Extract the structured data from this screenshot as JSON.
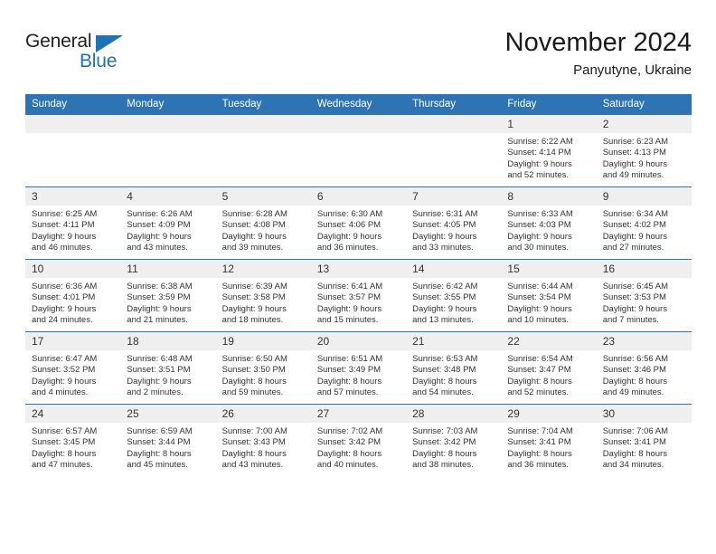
{
  "logo": {
    "word1": "General",
    "word2": "Blue",
    "triangle_color": "#1f72b8"
  },
  "header": {
    "title": "November 2024",
    "subtitle": "Panyutyne, Ukraine"
  },
  "theme": {
    "header_blue": "#2e74b5",
    "daynum_bg": "#efefef",
    "text": "#333333"
  },
  "weekdays": [
    "Sunday",
    "Monday",
    "Tuesday",
    "Wednesday",
    "Thursday",
    "Friday",
    "Saturday"
  ],
  "weeks": [
    [
      {
        "day": "",
        "sunrise": "",
        "sunset": "",
        "daylight1": "",
        "daylight2": ""
      },
      {
        "day": "",
        "sunrise": "",
        "sunset": "",
        "daylight1": "",
        "daylight2": ""
      },
      {
        "day": "",
        "sunrise": "",
        "sunset": "",
        "daylight1": "",
        "daylight2": ""
      },
      {
        "day": "",
        "sunrise": "",
        "sunset": "",
        "daylight1": "",
        "daylight2": ""
      },
      {
        "day": "",
        "sunrise": "",
        "sunset": "",
        "daylight1": "",
        "daylight2": ""
      },
      {
        "day": "1",
        "sunrise": "Sunrise: 6:22 AM",
        "sunset": "Sunset: 4:14 PM",
        "daylight1": "Daylight: 9 hours",
        "daylight2": "and 52 minutes."
      },
      {
        "day": "2",
        "sunrise": "Sunrise: 6:23 AM",
        "sunset": "Sunset: 4:13 PM",
        "daylight1": "Daylight: 9 hours",
        "daylight2": "and 49 minutes."
      }
    ],
    [
      {
        "day": "3",
        "sunrise": "Sunrise: 6:25 AM",
        "sunset": "Sunset: 4:11 PM",
        "daylight1": "Daylight: 9 hours",
        "daylight2": "and 46 minutes."
      },
      {
        "day": "4",
        "sunrise": "Sunrise: 6:26 AM",
        "sunset": "Sunset: 4:09 PM",
        "daylight1": "Daylight: 9 hours",
        "daylight2": "and 43 minutes."
      },
      {
        "day": "5",
        "sunrise": "Sunrise: 6:28 AM",
        "sunset": "Sunset: 4:08 PM",
        "daylight1": "Daylight: 9 hours",
        "daylight2": "and 39 minutes."
      },
      {
        "day": "6",
        "sunrise": "Sunrise: 6:30 AM",
        "sunset": "Sunset: 4:06 PM",
        "daylight1": "Daylight: 9 hours",
        "daylight2": "and 36 minutes."
      },
      {
        "day": "7",
        "sunrise": "Sunrise: 6:31 AM",
        "sunset": "Sunset: 4:05 PM",
        "daylight1": "Daylight: 9 hours",
        "daylight2": "and 33 minutes."
      },
      {
        "day": "8",
        "sunrise": "Sunrise: 6:33 AM",
        "sunset": "Sunset: 4:03 PM",
        "daylight1": "Daylight: 9 hours",
        "daylight2": "and 30 minutes."
      },
      {
        "day": "9",
        "sunrise": "Sunrise: 6:34 AM",
        "sunset": "Sunset: 4:02 PM",
        "daylight1": "Daylight: 9 hours",
        "daylight2": "and 27 minutes."
      }
    ],
    [
      {
        "day": "10",
        "sunrise": "Sunrise: 6:36 AM",
        "sunset": "Sunset: 4:01 PM",
        "daylight1": "Daylight: 9 hours",
        "daylight2": "and 24 minutes."
      },
      {
        "day": "11",
        "sunrise": "Sunrise: 6:38 AM",
        "sunset": "Sunset: 3:59 PM",
        "daylight1": "Daylight: 9 hours",
        "daylight2": "and 21 minutes."
      },
      {
        "day": "12",
        "sunrise": "Sunrise: 6:39 AM",
        "sunset": "Sunset: 3:58 PM",
        "daylight1": "Daylight: 9 hours",
        "daylight2": "and 18 minutes."
      },
      {
        "day": "13",
        "sunrise": "Sunrise: 6:41 AM",
        "sunset": "Sunset: 3:57 PM",
        "daylight1": "Daylight: 9 hours",
        "daylight2": "and 15 minutes."
      },
      {
        "day": "14",
        "sunrise": "Sunrise: 6:42 AM",
        "sunset": "Sunset: 3:55 PM",
        "daylight1": "Daylight: 9 hours",
        "daylight2": "and 13 minutes."
      },
      {
        "day": "15",
        "sunrise": "Sunrise: 6:44 AM",
        "sunset": "Sunset: 3:54 PM",
        "daylight1": "Daylight: 9 hours",
        "daylight2": "and 10 minutes."
      },
      {
        "day": "16",
        "sunrise": "Sunrise: 6:45 AM",
        "sunset": "Sunset: 3:53 PM",
        "daylight1": "Daylight: 9 hours",
        "daylight2": "and 7 minutes."
      }
    ],
    [
      {
        "day": "17",
        "sunrise": "Sunrise: 6:47 AM",
        "sunset": "Sunset: 3:52 PM",
        "daylight1": "Daylight: 9 hours",
        "daylight2": "and 4 minutes."
      },
      {
        "day": "18",
        "sunrise": "Sunrise: 6:48 AM",
        "sunset": "Sunset: 3:51 PM",
        "daylight1": "Daylight: 9 hours",
        "daylight2": "and 2 minutes."
      },
      {
        "day": "19",
        "sunrise": "Sunrise: 6:50 AM",
        "sunset": "Sunset: 3:50 PM",
        "daylight1": "Daylight: 8 hours",
        "daylight2": "and 59 minutes."
      },
      {
        "day": "20",
        "sunrise": "Sunrise: 6:51 AM",
        "sunset": "Sunset: 3:49 PM",
        "daylight1": "Daylight: 8 hours",
        "daylight2": "and 57 minutes."
      },
      {
        "day": "21",
        "sunrise": "Sunrise: 6:53 AM",
        "sunset": "Sunset: 3:48 PM",
        "daylight1": "Daylight: 8 hours",
        "daylight2": "and 54 minutes."
      },
      {
        "day": "22",
        "sunrise": "Sunrise: 6:54 AM",
        "sunset": "Sunset: 3:47 PM",
        "daylight1": "Daylight: 8 hours",
        "daylight2": "and 52 minutes."
      },
      {
        "day": "23",
        "sunrise": "Sunrise: 6:56 AM",
        "sunset": "Sunset: 3:46 PM",
        "daylight1": "Daylight: 8 hours",
        "daylight2": "and 49 minutes."
      }
    ],
    [
      {
        "day": "24",
        "sunrise": "Sunrise: 6:57 AM",
        "sunset": "Sunset: 3:45 PM",
        "daylight1": "Daylight: 8 hours",
        "daylight2": "and 47 minutes."
      },
      {
        "day": "25",
        "sunrise": "Sunrise: 6:59 AM",
        "sunset": "Sunset: 3:44 PM",
        "daylight1": "Daylight: 8 hours",
        "daylight2": "and 45 minutes."
      },
      {
        "day": "26",
        "sunrise": "Sunrise: 7:00 AM",
        "sunset": "Sunset: 3:43 PM",
        "daylight1": "Daylight: 8 hours",
        "daylight2": "and 43 minutes."
      },
      {
        "day": "27",
        "sunrise": "Sunrise: 7:02 AM",
        "sunset": "Sunset: 3:42 PM",
        "daylight1": "Daylight: 8 hours",
        "daylight2": "and 40 minutes."
      },
      {
        "day": "28",
        "sunrise": "Sunrise: 7:03 AM",
        "sunset": "Sunset: 3:42 PM",
        "daylight1": "Daylight: 8 hours",
        "daylight2": "and 38 minutes."
      },
      {
        "day": "29",
        "sunrise": "Sunrise: 7:04 AM",
        "sunset": "Sunset: 3:41 PM",
        "daylight1": "Daylight: 8 hours",
        "daylight2": "and 36 minutes."
      },
      {
        "day": "30",
        "sunrise": "Sunrise: 7:06 AM",
        "sunset": "Sunset: 3:41 PM",
        "daylight1": "Daylight: 8 hours",
        "daylight2": "and 34 minutes."
      }
    ]
  ]
}
